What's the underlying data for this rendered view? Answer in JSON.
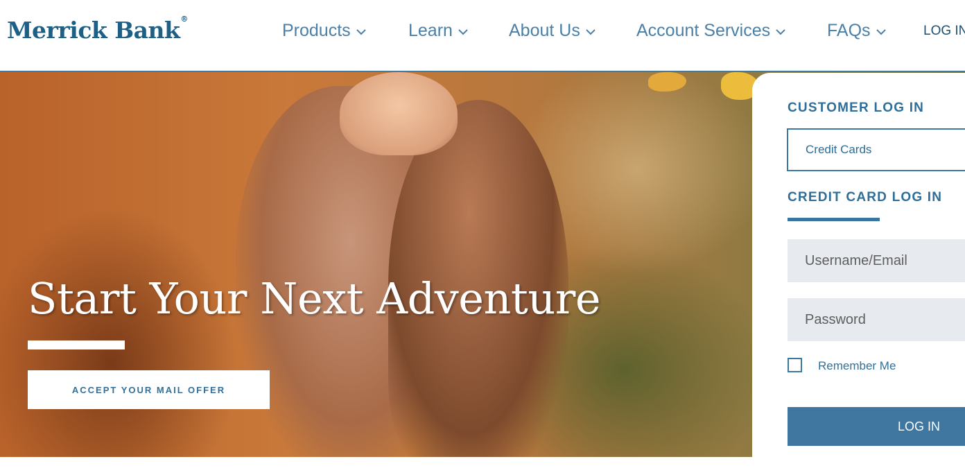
{
  "brand": {
    "name": "Merrick Bank",
    "mark": "®",
    "color": "#1e5f85"
  },
  "nav": {
    "items": [
      {
        "label": "Products"
      },
      {
        "label": "Learn"
      },
      {
        "label": "About Us"
      },
      {
        "label": "Account Services"
      },
      {
        "label": "FAQs"
      }
    ],
    "login_label": "LOG IN",
    "chevron_icon": "chevron-down-icon"
  },
  "hero": {
    "title": "Start Your Next Adventure",
    "cta_label": "ACCEPT YOUR MAIL OFFER"
  },
  "login": {
    "customer_heading": "CUSTOMER LOG IN",
    "account_type": "Credit Cards",
    "credit_heading": "CREDIT CARD LOG IN",
    "username_placeholder": "Username/Email",
    "password_placeholder": "Password",
    "remember_label": "Remember Me",
    "submit_label": "LOG IN"
  },
  "colors": {
    "accent": "#3f77a0",
    "nav_text": "#4a80a8",
    "input_bg": "#e7eaee"
  }
}
